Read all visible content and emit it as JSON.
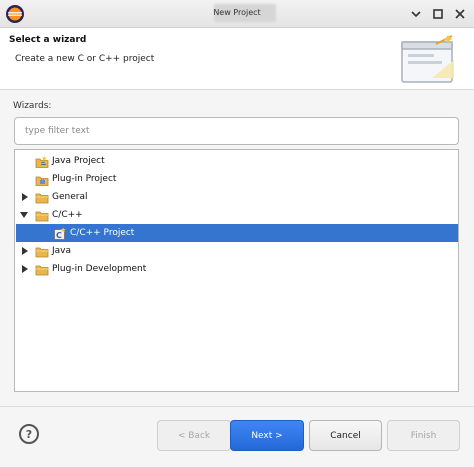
{
  "window": {
    "title": "New Project"
  },
  "header": {
    "title": "Select a wizard",
    "description": "Create a new C or C++ project"
  },
  "wizards": {
    "label": "Wizards:",
    "filter_placeholder": "type filter text"
  },
  "tree": {
    "items": [
      {
        "label": "Java Project",
        "icon": "java-project-icon",
        "level": 1,
        "twisty": "none",
        "selected": false
      },
      {
        "label": "Plug-in Project",
        "icon": "plugin-project-icon",
        "level": 1,
        "twisty": "none",
        "selected": false
      },
      {
        "label": "General",
        "icon": "folder-icon",
        "level": 0,
        "twisty": "collapsed",
        "selected": false
      },
      {
        "label": "C/C++",
        "icon": "folder-icon",
        "level": 0,
        "twisty": "expanded",
        "selected": false
      },
      {
        "label": "C/C++ Project",
        "icon": "c-project-icon",
        "level": 2,
        "twisty": "none",
        "selected": true
      },
      {
        "label": "Java",
        "icon": "folder-icon",
        "level": 0,
        "twisty": "collapsed",
        "selected": false
      },
      {
        "label": "Plug-in Development",
        "icon": "folder-icon",
        "level": 0,
        "twisty": "collapsed",
        "selected": false
      }
    ]
  },
  "buttons": {
    "back": "< Back",
    "next": "Next >",
    "cancel": "Cancel",
    "finish": "Finish",
    "help": "?"
  },
  "colors": {
    "selection": "#3574cf",
    "primary_button": "#2f78e6",
    "folder": "#e8b64c"
  }
}
